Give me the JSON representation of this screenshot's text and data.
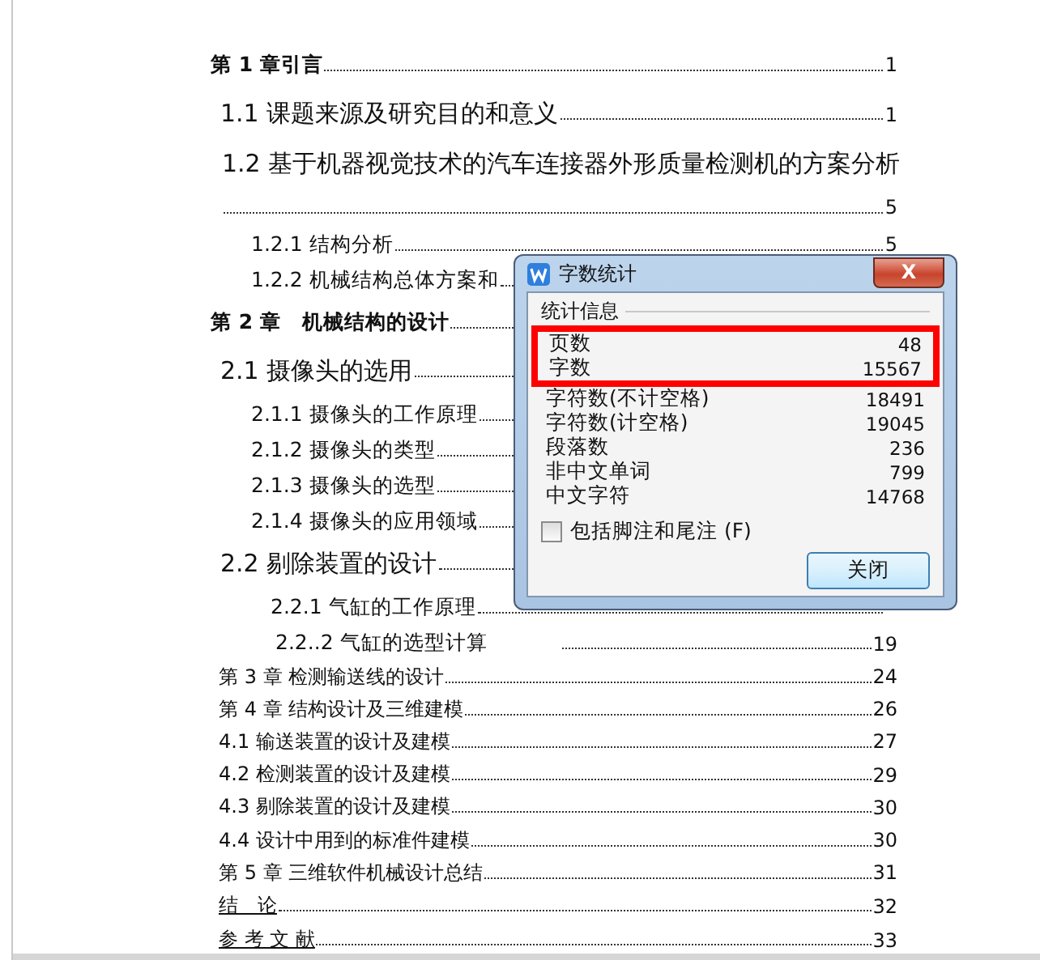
{
  "toc": [
    {
      "kind": "chapter",
      "text": "第 1 章引言",
      "page": "1"
    },
    {
      "kind": "section",
      "text": "1.1 课题来源及研究目的和意义",
      "page": "1"
    },
    {
      "kind": "wrapped",
      "text": "1.2 基于机器视觉技术的汽车连接器外形质量检测机的方案分析",
      "page": "5"
    },
    {
      "kind": "subsection",
      "text": "1.2.1 结构分析",
      "page": "5"
    },
    {
      "kind": "subsection",
      "text": "1.2.2 机械结构总体方案和"
    },
    {
      "kind": "chapter",
      "text": "第 2 章　机械结构的设计"
    },
    {
      "kind": "section",
      "text": "2.1 摄像头的选用"
    },
    {
      "kind": "subsection",
      "text": "2.1.1 摄像头的工作原理"
    },
    {
      "kind": "subsection",
      "text": "2.1.2 摄像头的类型"
    },
    {
      "kind": "subsection",
      "text": "2.1.3 摄像头的选型"
    },
    {
      "kind": "subsection",
      "text": "2.1.4 摄像头的应用领域"
    },
    {
      "kind": "section",
      "text": "2.2 剔除装置的设计"
    },
    {
      "kind": "subsubsection",
      "text": "2.2.1 气缸的工作原理"
    },
    {
      "kind": "gapped",
      "text": "2.2..2 气缸的选型计算",
      "page": "19"
    },
    {
      "kind": "entry",
      "text": "第 3 章 检测输送线的设计",
      "page": "24"
    },
    {
      "kind": "entry",
      "text": "第 4 章 结构设计及三维建模",
      "page": "26"
    },
    {
      "kind": "entry",
      "text": "4.1 输送装置的设计及建模",
      "page": "27"
    },
    {
      "kind": "entry",
      "text": "4.2 检测装置的设计及建模",
      "page": "29"
    },
    {
      "kind": "entry",
      "text": "4.3 剔除装置的设计及建模",
      "page": "30"
    },
    {
      "kind": "entry",
      "text": "4.4 设计中用到的标准件建模",
      "page": "30"
    },
    {
      "kind": "entry",
      "text": "第 5 章 三维软件机械设计总结",
      "page": "31"
    },
    {
      "kind": "closing",
      "text": "结　论",
      "page": "32"
    },
    {
      "kind": "closing",
      "text": "参 考 文 献",
      "page": "33"
    }
  ],
  "dialog": {
    "title": "字数统计",
    "close": "X",
    "group": "统计信息",
    "stats": [
      {
        "label": "页数",
        "value": "48",
        "highlighted": true
      },
      {
        "label": "字数",
        "value": "15567",
        "highlighted": true
      },
      {
        "label": "字符数(不计空格)",
        "value": "18491",
        "highlighted": false
      },
      {
        "label": "字符数(计空格)",
        "value": "19045",
        "highlighted": false
      },
      {
        "label": "段落数",
        "value": "236",
        "highlighted": false
      },
      {
        "label": "非中文单词",
        "value": "799",
        "highlighted": false
      },
      {
        "label": "中文字符",
        "value": "14768",
        "highlighted": false
      }
    ],
    "checkbox": {
      "label": "包括脚注和尾注 (F)",
      "checked": false
    },
    "button": "关闭"
  }
}
